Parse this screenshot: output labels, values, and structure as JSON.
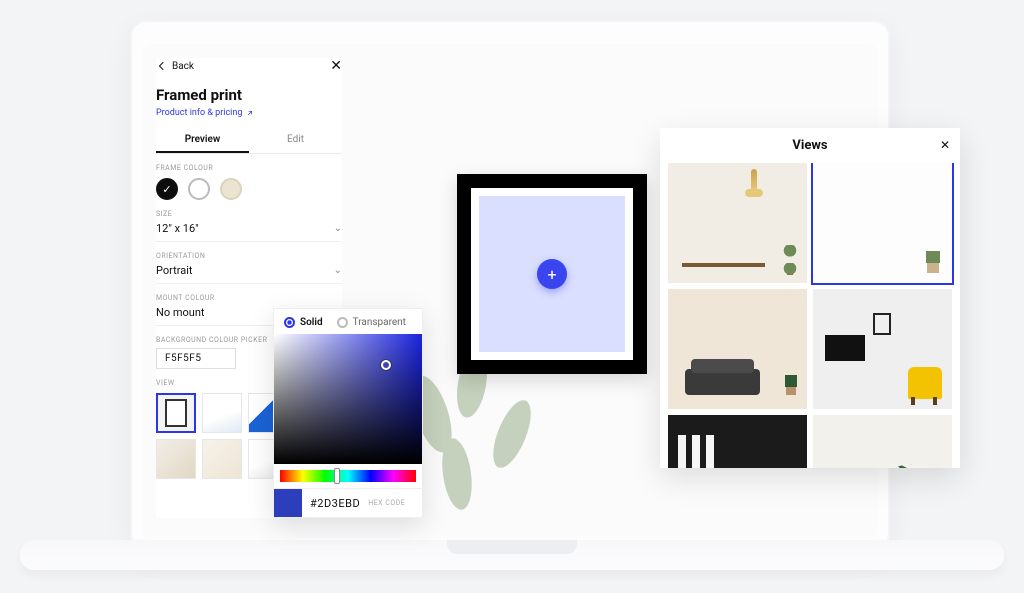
{
  "sidebar": {
    "back_label": "Back",
    "title": "Framed print",
    "info_link": "Product info & pricing",
    "tabs": {
      "preview": "Preview",
      "edit": "Edit"
    },
    "frame_colour_label": "FRAME COLOUR",
    "size_label": "SIZE",
    "size_value": "12\" x 16\"",
    "orientation_label": "ORIENTATION",
    "orientation_value": "Portrait",
    "mount_colour_label": "MOUNT COLOUR",
    "mount_colour_value": "No mount",
    "bg_picker_label": "BACKGROUND COLOUR PICKER",
    "bg_hex_value": "F5F5F5",
    "view_label": "VIEW"
  },
  "picker": {
    "solid_label": "Solid",
    "transparent_label": "Transparent",
    "hex_value": "#2D3EBD",
    "hex_code_label": "HEX CODE"
  },
  "views_panel": {
    "title": "Views"
  },
  "colors": {
    "accent": "#3a45ef",
    "picker_swatch": "#2D3EBD"
  }
}
